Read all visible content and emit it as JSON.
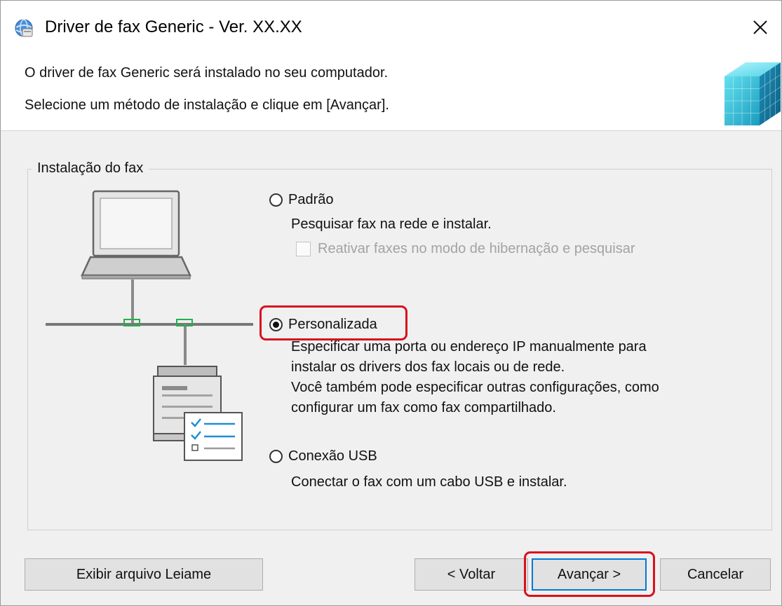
{
  "window": {
    "title": "Driver de fax Generic - Ver. XX.XX",
    "close_symbol": "✕",
    "app_icon": "installer-globe-icon"
  },
  "header": {
    "line1": "O driver de fax Generic será instalado no seu computador.",
    "line2": "Selecione um método de instalação e clique em [Avançar].",
    "icon": "cube-stack-icon"
  },
  "group": {
    "label": "Instalação do fax"
  },
  "options": {
    "padrao": {
      "label": "Padrão",
      "desc": "Pesquisar fax na rede e instalar.",
      "selected": false,
      "suboption": {
        "label": "Reativar faxes no modo de hibernação e pesquisar",
        "checked": false,
        "enabled": false
      }
    },
    "personalizada": {
      "label": "Personalizada",
      "selected": true,
      "desc_lines": [
        "Especificar uma porta ou endereço IP manualmente para",
        "instalar os drivers dos fax locais ou de rede.",
        "Você também pode especificar outras configurações, como",
        "configurar um fax como fax compartilhado."
      ]
    },
    "usb": {
      "label": "Conexão USB",
      "desc": "Conectar o fax com um cabo USB e instalar.",
      "selected": false
    }
  },
  "buttons": {
    "readme": "Exibir arquivo Leiame",
    "back": "< Voltar",
    "next": "Avançar >",
    "cancel": "Cancelar"
  },
  "colors": {
    "highlight": "#d8101e",
    "default_button_border": "#0078d7",
    "network_connector": "#22b14c"
  }
}
